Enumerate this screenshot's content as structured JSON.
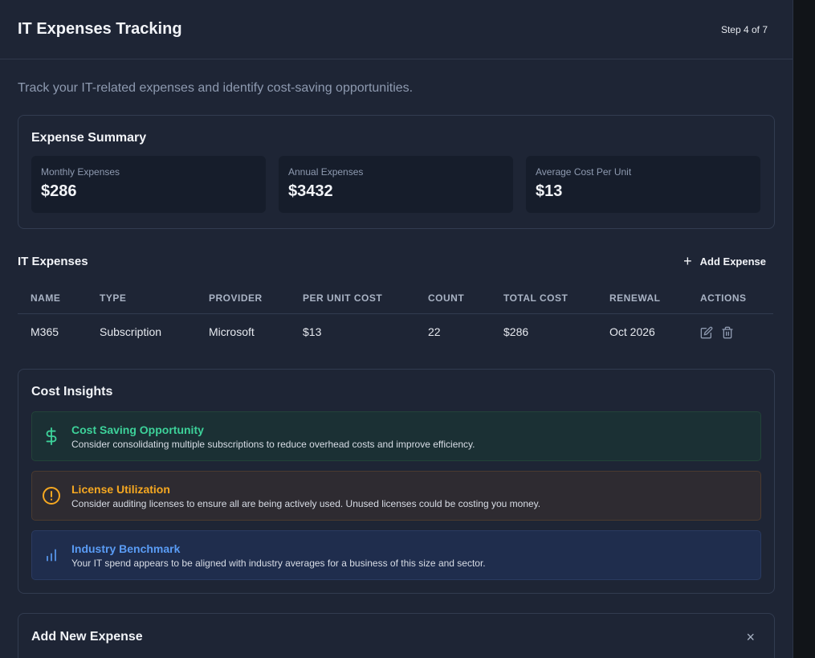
{
  "header": {
    "title": "IT Expenses Tracking",
    "step": "Step 4 of 7"
  },
  "subtitle": "Track your IT-related expenses and identify cost-saving opportunities.",
  "summary": {
    "title": "Expense Summary",
    "stats": [
      {
        "label": "Monthly Expenses",
        "value": "$286"
      },
      {
        "label": "Annual Expenses",
        "value": "$3432"
      },
      {
        "label": "Average Cost Per Unit",
        "value": "$13"
      }
    ]
  },
  "expenses": {
    "title": "IT Expenses",
    "add_label": "Add Expense",
    "columns": [
      "NAME",
      "TYPE",
      "PROVIDER",
      "PER UNIT COST",
      "COUNT",
      "TOTAL COST",
      "RENEWAL",
      "ACTIONS"
    ],
    "rows": [
      {
        "name": "M365",
        "type": "Subscription",
        "provider": "Microsoft",
        "per_unit": "$13",
        "count": "22",
        "total": "$286",
        "renewal": "Oct 2026"
      }
    ]
  },
  "insights": {
    "title": "Cost Insights",
    "items": [
      {
        "icon": "dollar-icon",
        "color": "#3dd29a",
        "title": "Cost Saving Opportunity",
        "desc": "Consider consolidating multiple subscriptions to reduce overhead costs and improve efficiency."
      },
      {
        "icon": "alert-circle-icon",
        "color": "#f6a821",
        "title": "License Utilization",
        "desc": "Consider auditing licenses to ensure all are being actively used. Unused licenses could be costing you money."
      },
      {
        "icon": "bar-chart-icon",
        "color": "#5a9cf5",
        "title": "Industry Benchmark",
        "desc": "Your IT spend appears to be aligned with industry averages for a business of this size and sector."
      }
    ]
  },
  "add_new": {
    "title": "Add New Expense",
    "close": "×"
  }
}
